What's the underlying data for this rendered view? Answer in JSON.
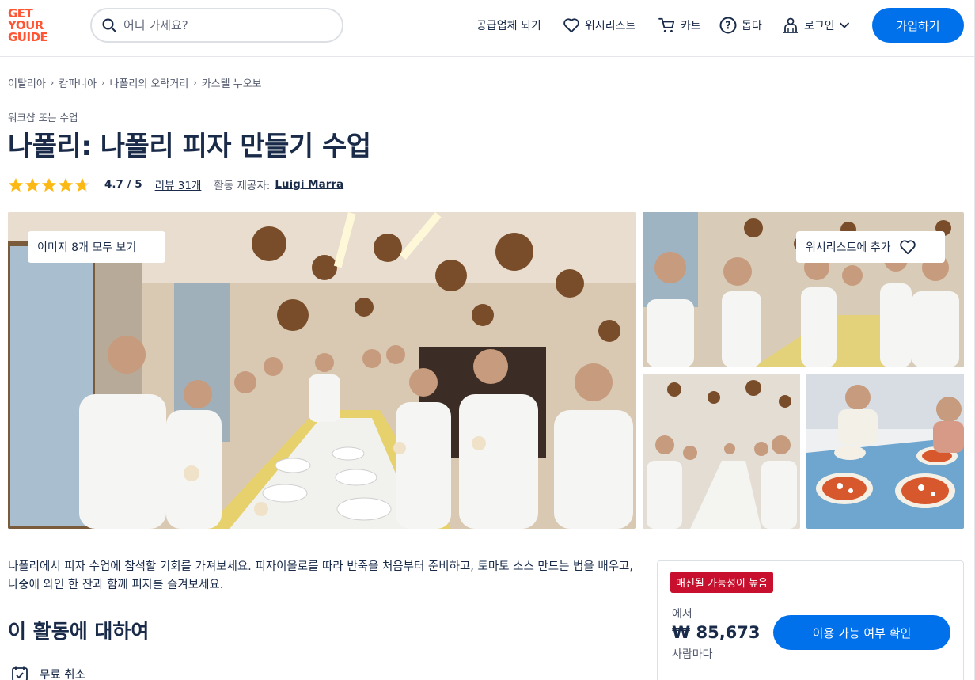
{
  "logo": {
    "line1": "GET",
    "line2": "YOUR",
    "line3": "GUIDE"
  },
  "search": {
    "placeholder": "어디 가세요?"
  },
  "nav": {
    "supplier": "공급업체 되기",
    "wishlist": "위시리스트",
    "cart": "카트",
    "help": "돕다",
    "login": "로그인",
    "signup": "가입하기"
  },
  "breadcrumb": [
    "이탈리아",
    "캄파니아",
    "나폴리의 오락거리",
    "카스텔 누오보"
  ],
  "category": "워크샵 또는 수업",
  "title": "나폴리: 나폴리 피자 만들기 수업",
  "rating": {
    "value": "4.7 / 5",
    "stars": 4.7,
    "reviews": "리뷰 31개",
    "provider_label": "활동 제공자:",
    "provider": "Luigi Marra"
  },
  "gallery": {
    "view_all": "이미지 8개 모두 보기",
    "add_wishlist": "위시리스트에 추가"
  },
  "description": "나폴리에서 피자 수업에 참석할 기회를 가져보세요. 피자이올로를 따라 반죽을 처음부터 준비하고, 토마토 소스 만드는 법을 배우고, 나중에 와인 한 잔과 함께 피자를 즐겨보세요.",
  "about": {
    "heading": "이 활동에 대하여",
    "feature": "무료 취소"
  },
  "booking": {
    "badge": "매진될 가능성이 높음",
    "from": "에서",
    "price": "₩ 85,673",
    "per": "사람마다",
    "check": "이용 가능 여부 확인"
  },
  "colors": {
    "brand": "#ff5533",
    "primary": "#0071eb",
    "badge": "#c8102e",
    "star": "#fdb913",
    "text": "#1a2b49"
  }
}
